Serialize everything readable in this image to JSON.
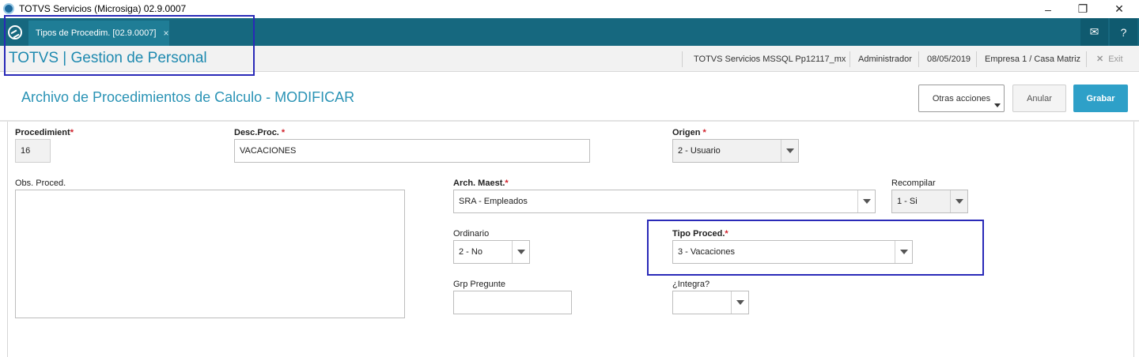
{
  "window": {
    "title": "TOTVS Servicios (Microsiga) 02.9.0007",
    "minimize": "–",
    "restore": "❐",
    "close": "✕"
  },
  "tabbar": {
    "tab_label": "Tipos de Procedim. [02.9.0007]",
    "tab_close": "×",
    "mail_icon": "✉",
    "help_icon": "?"
  },
  "header": {
    "brand": "TOTVS | Gestion de Personal",
    "server": "TOTVS Servicios MSSQL Pp12117_mx",
    "user": "Administrador",
    "date": "08/05/2019",
    "company": "Empresa 1 / Casa Matriz",
    "exit_icon": "✕",
    "exit_label": "Exit"
  },
  "content": {
    "title": "Archivo de Procedimientos de Calculo - MODIFICAR",
    "otras_acciones": "Otras acciones",
    "anular": "Anular",
    "grabar": "Grabar"
  },
  "form": {
    "procedimient": {
      "label": "Procedimient",
      "req": "*",
      "value": "16"
    },
    "desc_proc": {
      "label": "Desc.Proc.",
      "req": " *",
      "value": "VACACIONES"
    },
    "origen": {
      "label": "Origen",
      "req": " *",
      "value": "2 - Usuario"
    },
    "obs_proced": {
      "label": "Obs. Proced.",
      "value": ""
    },
    "arch_maest": {
      "label": "Arch. Maest.",
      "req": "*",
      "value": "SRA - Empleados"
    },
    "recompilar": {
      "label": "Recompilar",
      "value": "1 - Si"
    },
    "ordinario": {
      "label": "Ordinario",
      "value": "2 - No"
    },
    "tipo_proced": {
      "label": "Tipo Proced.",
      "req": "*",
      "value": "3 - Vacaciones"
    },
    "grp_pregunte": {
      "label": "Grp Pregunte",
      "value": ""
    },
    "integra": {
      "label": "¿Integra?",
      "value": ""
    }
  },
  "colors": {
    "tabbar": "#16687f",
    "accent": "#2a93b5",
    "grabar": "#2ea0c8",
    "highlight": "#2a2ab8",
    "required": "#d0202a"
  }
}
